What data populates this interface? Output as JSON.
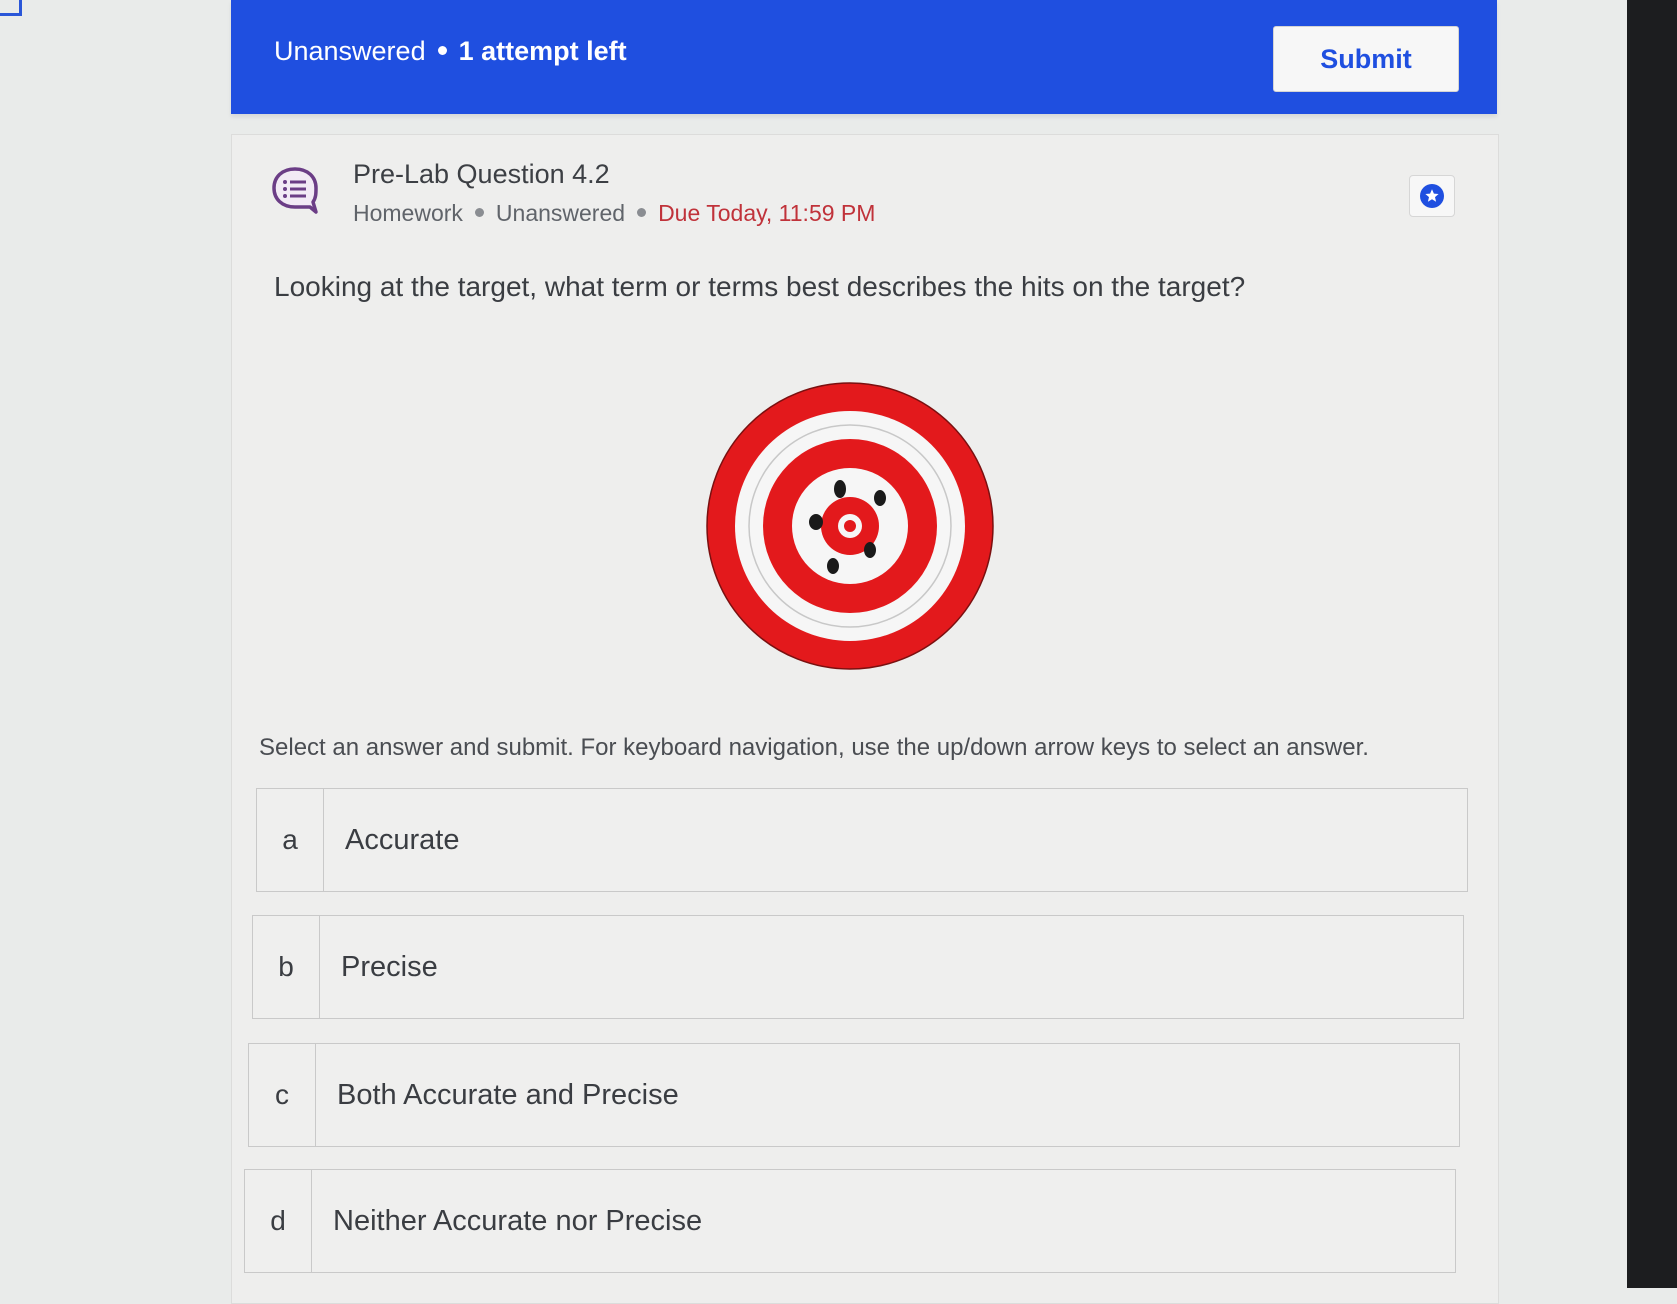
{
  "status_bar": {
    "state": "Unanswered",
    "attempts": "1 attempt left",
    "submit_label": "Submit",
    "color": "#1f4fe0"
  },
  "question": {
    "icon": "question-chat-icon",
    "title": "Pre-Lab Question 4.2",
    "meta": {
      "type": "Homework",
      "status": "Unanswered",
      "due": "Due Today, 11:59 PM"
    },
    "star_icon": "star-icon",
    "prompt": "Looking at the target, what term or terms best describes the hits on the target?",
    "image": "target-image",
    "instructions": "Select an answer and submit. For keyboard navigation, use the up/down arrow keys to select an answer."
  },
  "options": [
    {
      "letter": "a",
      "label": "Accurate"
    },
    {
      "letter": "b",
      "label": "Precise"
    },
    {
      "letter": "c",
      "label": "Both Accurate and Precise"
    },
    {
      "letter": "d",
      "label": "Neither Accurate nor Precise"
    }
  ],
  "colors": {
    "due": "#c0323a",
    "target_red": "#e3191c",
    "icon_purple": "#6b3d86"
  }
}
